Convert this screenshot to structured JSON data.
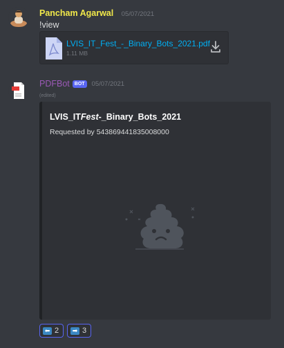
{
  "messages": [
    {
      "author": "Pancham Agarwal",
      "timestamp": "05/07/2021",
      "text": "!view",
      "attachment": {
        "file_name": "LVIS_IT_Fest_-_Binary_Bots_2021.pdf",
        "file_size": "1.11 MB",
        "icon": "pdf-file-icon"
      }
    },
    {
      "author": "PDFBot",
      "badge": "BOT",
      "timestamp": "05/07/2021",
      "edited": "(edited)",
      "embed": {
        "title_prefix": "LVIS_IT",
        "title_italic": "Fest",
        "title_suffix": "-_Binary_Bots_2021",
        "description": "Requested by 543869441835008000"
      },
      "buttons": [
        {
          "icon": "⬅",
          "label": "2"
        },
        {
          "icon": "➡",
          "label": "3"
        }
      ]
    }
  ],
  "colors": {
    "background": "#36393f",
    "username_1": "#f1e84a",
    "username_2": "#9b59b6",
    "link": "#00aff4",
    "accent": "#5865f2"
  }
}
